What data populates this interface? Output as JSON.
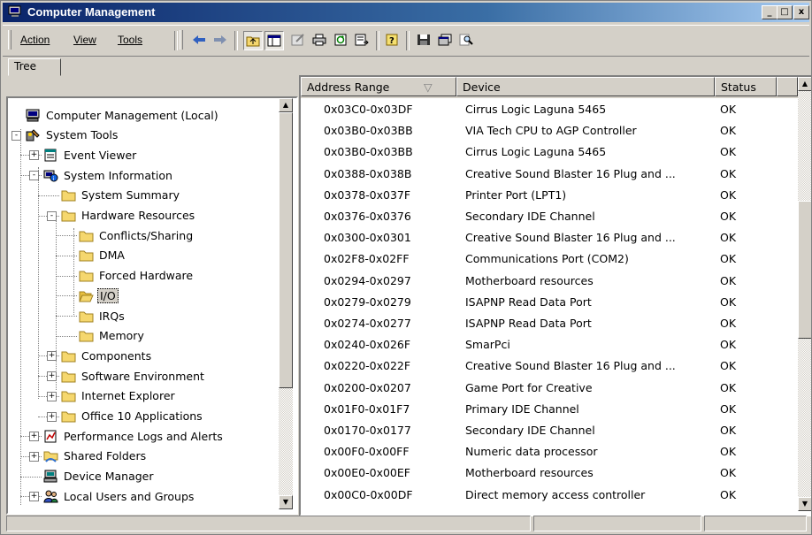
{
  "window": {
    "title": "Computer Management"
  },
  "caption_buttons": {
    "minimize": "_",
    "maximize": "□",
    "close": "x"
  },
  "menu": {
    "action": "Action",
    "view": "View",
    "tools": "Tools"
  },
  "tree_tab": "Tree",
  "tree": [
    {
      "label": "Computer Management (Local)",
      "icon": "computer-management-icon",
      "level": 0,
      "toggle": "",
      "selected": false
    },
    {
      "label": "System Tools",
      "icon": "system-tools-icon",
      "level": 0,
      "toggle": "-",
      "selected": false
    },
    {
      "label": "Event Viewer",
      "icon": "event-viewer-icon",
      "level": 1,
      "toggle": "+",
      "selected": false
    },
    {
      "label": "System Information",
      "icon": "system-information-icon",
      "level": 1,
      "toggle": "-",
      "selected": false
    },
    {
      "label": "System Summary",
      "icon": "folder-icon",
      "level": 2,
      "toggle": "",
      "selected": false
    },
    {
      "label": "Hardware Resources",
      "icon": "folder-icon",
      "level": 2,
      "toggle": "-",
      "selected": false
    },
    {
      "label": "Conflicts/Sharing",
      "icon": "folder-icon",
      "level": 3,
      "toggle": "",
      "selected": false
    },
    {
      "label": "DMA",
      "icon": "folder-icon",
      "level": 3,
      "toggle": "",
      "selected": false
    },
    {
      "label": "Forced Hardware",
      "icon": "folder-icon",
      "level": 3,
      "toggle": "",
      "selected": false
    },
    {
      "label": "I/O",
      "icon": "folder-open-icon",
      "level": 3,
      "toggle": "",
      "selected": true
    },
    {
      "label": "IRQs",
      "icon": "folder-icon",
      "level": 3,
      "toggle": "",
      "selected": false
    },
    {
      "label": "Memory",
      "icon": "folder-icon",
      "level": 3,
      "toggle": "",
      "selected": false
    },
    {
      "label": "Components",
      "icon": "folder-icon",
      "level": 2,
      "toggle": "+",
      "selected": false
    },
    {
      "label": "Software Environment",
      "icon": "folder-icon",
      "level": 2,
      "toggle": "+",
      "selected": false
    },
    {
      "label": "Internet Explorer",
      "icon": "folder-icon",
      "level": 2,
      "toggle": "+",
      "selected": false
    },
    {
      "label": "Office 10 Applications",
      "icon": "folder-icon",
      "level": 2,
      "toggle": "+",
      "selected": false
    },
    {
      "label": "Performance Logs and Alerts",
      "icon": "performance-logs-icon",
      "level": 1,
      "toggle": "+",
      "selected": false
    },
    {
      "label": "Shared Folders",
      "icon": "shared-folders-icon",
      "level": 1,
      "toggle": "+",
      "selected": false
    },
    {
      "label": "Device Manager",
      "icon": "device-manager-icon",
      "level": 1,
      "toggle": "",
      "selected": false
    },
    {
      "label": "Local Users and Groups",
      "icon": "local-users-icon",
      "level": 1,
      "toggle": "+",
      "selected": false
    }
  ],
  "list": {
    "columns": {
      "address": "Address Range",
      "sort_indicator": "▽",
      "device": "Device",
      "status": "Status"
    },
    "rows": [
      {
        "address": "0x03C0-0x03DF",
        "device": "Cirrus Logic Laguna 5465",
        "status": "OK"
      },
      {
        "address": "0x03B0-0x03BB",
        "device": "VIA Tech CPU to AGP Controller",
        "status": "OK"
      },
      {
        "address": "0x03B0-0x03BB",
        "device": "Cirrus Logic Laguna 5465",
        "status": "OK"
      },
      {
        "address": "0x0388-0x038B",
        "device": "Creative Sound Blaster 16 Plug and ...",
        "status": "OK"
      },
      {
        "address": "0x0378-0x037F",
        "device": "Printer Port (LPT1)",
        "status": "OK"
      },
      {
        "address": "0x0376-0x0376",
        "device": "Secondary IDE Channel",
        "status": "OK"
      },
      {
        "address": "0x0300-0x0301",
        "device": "Creative Sound Blaster 16 Plug and ...",
        "status": "OK"
      },
      {
        "address": "0x02F8-0x02FF",
        "device": "Communications Port (COM2)",
        "status": "OK"
      },
      {
        "address": "0x0294-0x0297",
        "device": "Motherboard resources",
        "status": "OK"
      },
      {
        "address": "0x0279-0x0279",
        "device": "ISAPNP Read Data Port",
        "status": "OK"
      },
      {
        "address": "0x0274-0x0277",
        "device": "ISAPNP Read Data Port",
        "status": "OK"
      },
      {
        "address": "0x0240-0x026F",
        "device": "SmarPci",
        "status": "OK"
      },
      {
        "address": "0x0220-0x022F",
        "device": "Creative Sound Blaster 16 Plug and ...",
        "status": "OK"
      },
      {
        "address": "0x0200-0x0207",
        "device": "Game Port for Creative",
        "status": "OK"
      },
      {
        "address": "0x01F0-0x01F7",
        "device": "Primary IDE Channel",
        "status": "OK"
      },
      {
        "address": "0x0170-0x0177",
        "device": "Secondary IDE Channel",
        "status": "OK"
      },
      {
        "address": "0x00F0-0x00FF",
        "device": "Numeric data processor",
        "status": "OK"
      },
      {
        "address": "0x00E0-0x00EF",
        "device": "Motherboard resources",
        "status": "OK"
      },
      {
        "address": "0x00C0-0x00DF",
        "device": "Direct memory access controller",
        "status": "OK"
      }
    ]
  },
  "colors": {
    "title_bar": "#0a246a",
    "window_face": "#d4d0c8",
    "folder": "#f5d76e"
  }
}
